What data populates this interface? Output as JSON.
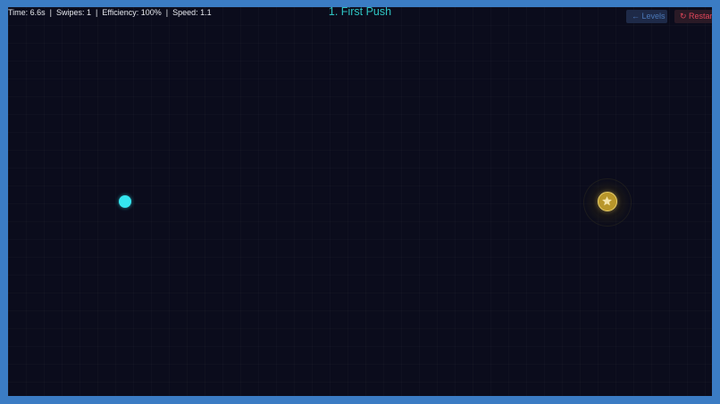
{
  "hud": {
    "stats": "Time: 6.6s  |  Swipes: 1  |  Efficiency: 100%  |  Speed: 1.1",
    "level_title": "1. First Push"
  },
  "buttons": {
    "levels_label": "← Levels",
    "restart_label": "↻ Restart"
  },
  "colors": {
    "frame": "#3b7cc4",
    "arena_background": "#0b0c1c",
    "ball": "#35e6f0",
    "goal": "#b8962a",
    "title": "#2fc4c4"
  },
  "icons": {
    "goal": "star-icon"
  }
}
